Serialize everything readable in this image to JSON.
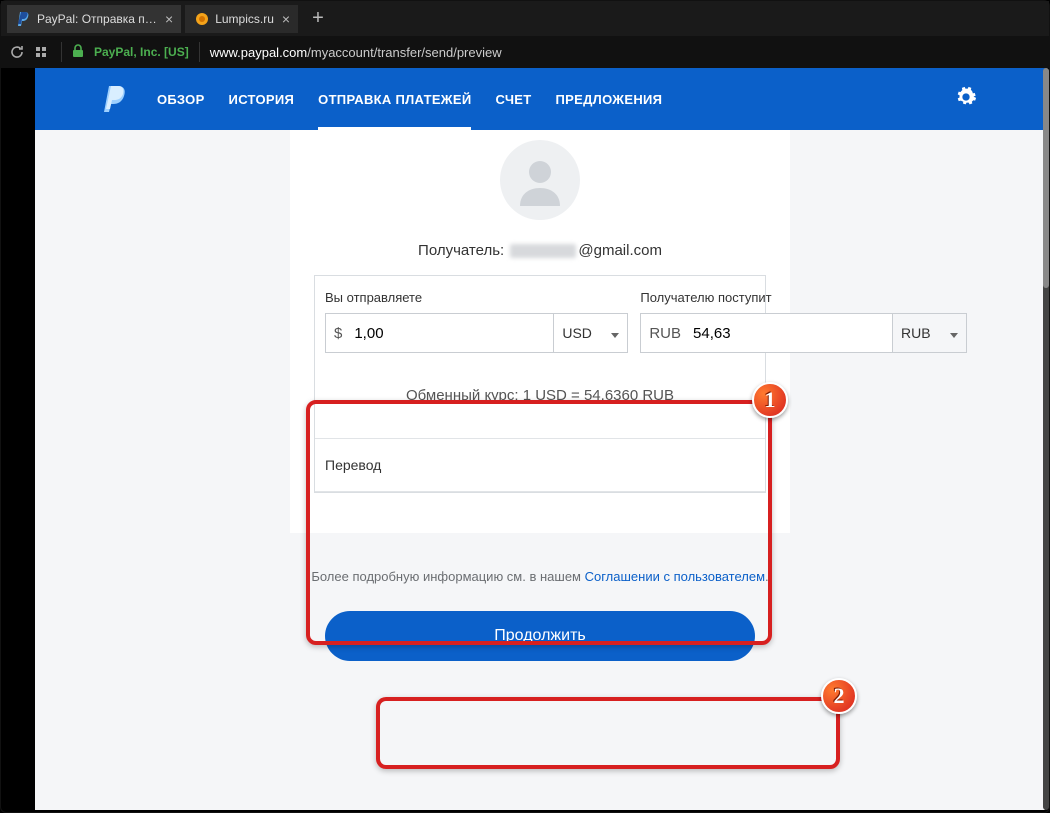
{
  "browser": {
    "tabs": [
      {
        "title": "PayPal: Отправка платеж",
        "active": true,
        "favicon": "paypal"
      },
      {
        "title": "Lumpics.ru",
        "active": false,
        "favicon": "lumpics"
      }
    ],
    "ev_label": "PayPal, Inc. [US]",
    "url_host": "www.paypal.com",
    "url_path": "/myaccount/transfer/send/preview"
  },
  "header": {
    "nav": {
      "overview": "ОБЗОР",
      "history": "ИСТОРИЯ",
      "send": "ОТПРАВКА ПЛАТЕЖЕЙ",
      "account": "СЧЕТ",
      "offers": "ПРЕДЛОЖЕНИЯ"
    }
  },
  "main": {
    "recipient_label": "Получатель:",
    "recipient_email_suffix": "@gmail.com",
    "you_send_label": "Вы отправляете",
    "recipient_gets_label": "Получателю поступит",
    "send_prefix": "$",
    "send_value": "1,00",
    "send_currency": "USD",
    "recv_prefix": "RUB",
    "recv_value": "54,63",
    "recv_currency": "RUB",
    "rate_text": "Обменный курс: 1 USD = 54,6360 RUB",
    "transfer_label": "Перевод"
  },
  "footer": {
    "text_prefix": "Более подробную информацию см. в нашем ",
    "link_text": "Соглашении с пользователем",
    "text_suffix": "."
  },
  "button": {
    "continue": "Продолжить"
  },
  "annotations": {
    "one": "1",
    "two": "2"
  }
}
